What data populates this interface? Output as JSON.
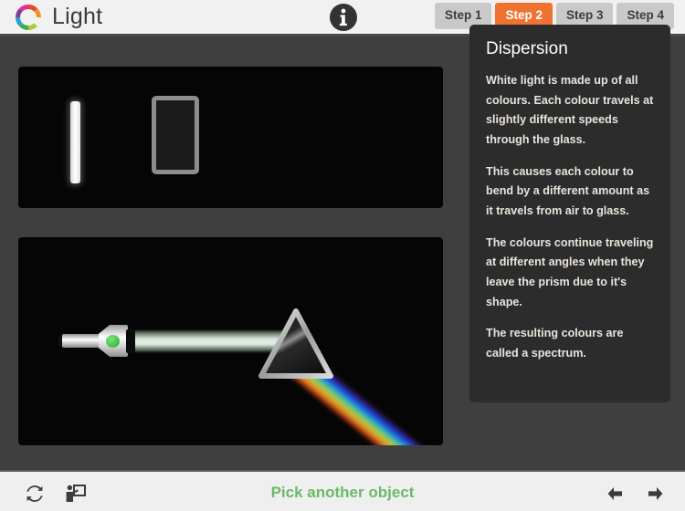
{
  "header": {
    "logo_icon": "colour-wheel-logo-icon",
    "title": "Light",
    "info_icon": "info-circle-icon",
    "steps": [
      {
        "label": "Step 1",
        "active": false
      },
      {
        "label": "Step 2",
        "active": true
      },
      {
        "label": "Step 3",
        "active": false
      },
      {
        "label": "Step 4",
        "active": false
      }
    ],
    "active_step_color": "#ef7330",
    "inactive_step_color": "#c9c9c9",
    "background_color": "#f1f1f1"
  },
  "stage": {
    "background_color": "#3f3f3f",
    "top_canvas": {
      "name": "object-selection-canvas",
      "background_color": "#050505",
      "items": [
        {
          "name": "white-light-bar",
          "type": "light-source"
        },
        {
          "name": "glass-block-object",
          "type": "rectangle-object"
        }
      ]
    },
    "main_canvas": {
      "name": "simulation-canvas",
      "background_color": "#050505",
      "items": [
        {
          "name": "torch",
          "button_color": "#3fbf44"
        },
        {
          "name": "white-light-beam"
        },
        {
          "name": "triangular-prism"
        },
        {
          "name": "dispersed-spectrum"
        }
      ]
    }
  },
  "info_panel": {
    "background_color": "#2c2c2c",
    "title": "Dispersion",
    "paragraphs": [
      "White light is made up of all colours. Each colour travels at slightly different speeds through the glass.",
      "This causes each colour to bend by a different amount as it travels from air to glass.",
      "The colours continue traveling at different angles when they leave the prism due to it's shape.",
      "The resulting colours are called a spectrum."
    ]
  },
  "footer": {
    "background_color": "#efefef",
    "reset_icon": "refresh-icon",
    "present_icon": "teacher-presentation-icon",
    "pick_label": "Pick another object",
    "pick_label_color": "#6aba6a",
    "prev_icon": "arrow-left-icon",
    "next_icon": "arrow-right-icon"
  }
}
